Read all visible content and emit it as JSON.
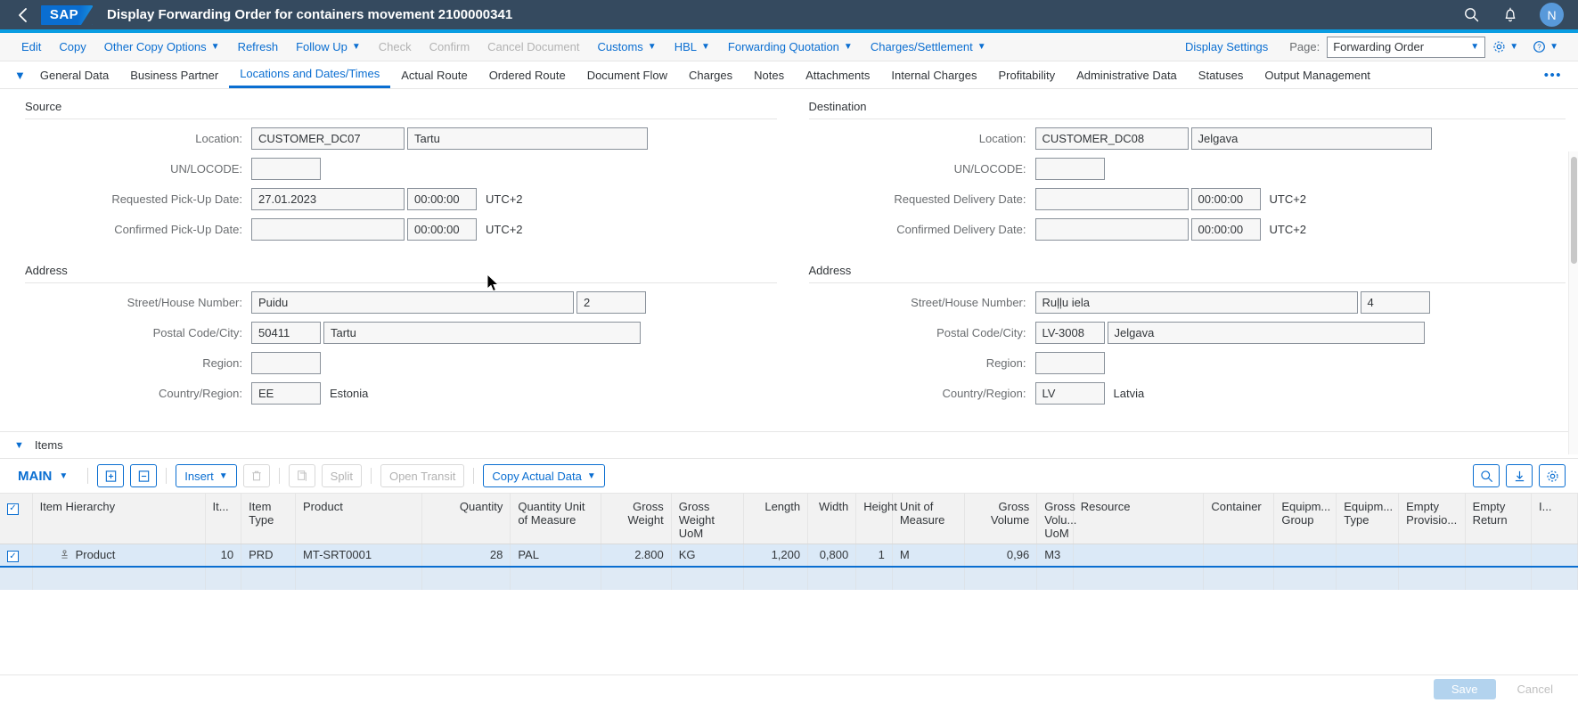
{
  "shell": {
    "back_icon": "chevron-left-icon",
    "logo_text": "SAP",
    "title": "Display Forwarding Order for containers movement 2100000341",
    "search_icon": "search-icon",
    "bell_icon": "notification-bell-icon",
    "avatar_initial": "N"
  },
  "toolbar": {
    "items": [
      {
        "label": "Edit",
        "disabled": false,
        "menu": false
      },
      {
        "label": "Copy",
        "disabled": false,
        "menu": false
      },
      {
        "label": "Other Copy Options",
        "disabled": false,
        "menu": true
      },
      {
        "label": "Refresh",
        "disabled": false,
        "menu": false
      },
      {
        "label": "Follow Up",
        "disabled": false,
        "menu": true
      },
      {
        "label": "Check",
        "disabled": true,
        "menu": false
      },
      {
        "label": "Confirm",
        "disabled": true,
        "menu": false
      },
      {
        "label": "Cancel Document",
        "disabled": true,
        "menu": false
      },
      {
        "label": "Customs",
        "disabled": false,
        "menu": true
      },
      {
        "label": "HBL",
        "disabled": false,
        "menu": true
      },
      {
        "label": "Forwarding Quotation",
        "disabled": false,
        "menu": true
      },
      {
        "label": "Charges/Settlement",
        "disabled": false,
        "menu": true
      }
    ],
    "display_settings": "Display Settings",
    "page_label": "Page:",
    "page_value": "Forwarding Order",
    "settings_icon": "gear-icon",
    "help_icon": "help-question-icon"
  },
  "tabs": {
    "expand_icon": "chevron-down-icon",
    "items": [
      "General Data",
      "Business Partner",
      "Locations and Dates/Times",
      "Actual Route",
      "Ordered Route",
      "Document Flow",
      "Charges",
      "Notes",
      "Attachments",
      "Internal Charges",
      "Profitability",
      "Administrative Data",
      "Statuses",
      "Output Management"
    ],
    "active": "Locations and Dates/Times",
    "overflow": "•••"
  },
  "source": {
    "section_title": "Source",
    "address_title": "Address",
    "fields": {
      "location_label": "Location:",
      "location_code": "CUSTOMER_DC07",
      "location_name": "Tartu",
      "unlocode_label": "UN/LOCODE:",
      "unlocode_value": "",
      "requested_label": "Requested Pick-Up Date:",
      "requested_date": "27.01.2023",
      "requested_time": "00:00:00",
      "requested_tz": "UTC+2",
      "confirmed_label": "Confirmed Pick-Up Date:",
      "confirmed_date": "",
      "confirmed_time": "00:00:00",
      "confirmed_tz": "UTC+2",
      "street_label": "Street/House Number:",
      "street": "Puidu",
      "house": "2",
      "postal_label": "Postal Code/City:",
      "postal": "50411",
      "city": "Tartu",
      "region_label": "Region:",
      "region": "",
      "country_label": "Country/Region:",
      "country_code": "EE",
      "country_name": "Estonia"
    }
  },
  "destination": {
    "section_title": "Destination",
    "address_title": "Address",
    "fields": {
      "location_label": "Location:",
      "location_code": "CUSTOMER_DC08",
      "location_name": "Jelgava",
      "unlocode_label": "UN/LOCODE:",
      "unlocode_value": "",
      "requested_label": "Requested Delivery Date:",
      "requested_date": "",
      "requested_time": "00:00:00",
      "requested_tz": "UTC+2",
      "confirmed_label": "Confirmed Delivery Date:",
      "confirmed_date": "",
      "confirmed_time": "00:00:00",
      "confirmed_tz": "UTC+2",
      "street_label": "Street/House Number:",
      "street": "Ruļļu iela",
      "house": "4",
      "postal_label": "Postal Code/City:",
      "postal": "LV-3008",
      "city": "Jelgava",
      "region_label": "Region:",
      "region": "",
      "country_label": "Country/Region:",
      "country_code": "LV",
      "country_name": "Latvia"
    }
  },
  "items": {
    "section_label": "Items",
    "variant": "MAIN",
    "buttons": {
      "insert_row_icon": "insert-row-icon",
      "delete_row_icon": "remove-row-icon",
      "insert": "Insert",
      "trash_icon": "trash-icon",
      "duplicate_icon": "duplicate-icon",
      "split": "Split",
      "open_transit": "Open Transit",
      "copy_actual_data": "Copy Actual Data",
      "search_icon": "search-icon",
      "download_icon": "download-icon",
      "settings_icon": "gear-icon"
    },
    "columns": [
      "Item Hierarchy",
      "It...",
      "Item Type",
      "Product",
      "Quantity",
      "Quantity Unit of Measure",
      "Gross Weight",
      "Gross Weight UoM",
      "Length",
      "Width",
      "Height",
      "Unit of Measure",
      "Gross Volume",
      "Gross Volu... UoM",
      "Resource",
      "Container",
      "Equipm... Group",
      "Equipm... Type",
      "Empty Provisio...",
      "Empty Return",
      "I..."
    ],
    "rows": [
      {
        "selected": true,
        "hierarchy": "Product",
        "item_no": "10",
        "item_type": "PRD",
        "product": "MT-SRT0001",
        "quantity": "28",
        "quantity_uom": "PAL",
        "gross_weight": "2.800",
        "gross_weight_uom": "KG",
        "length": "1,200",
        "width": "0,800",
        "height": "1",
        "unit_of_measure": "M",
        "gross_volume": "0,96",
        "gross_volume_uom": "M3",
        "resource": "",
        "container": "",
        "equipment_group": "",
        "equipment_type": "",
        "empty_provision": "",
        "empty_return": "",
        "extra": ""
      }
    ]
  },
  "footer": {
    "save": "Save",
    "cancel": "Cancel"
  },
  "colors": {
    "shell_bg": "#354a5f",
    "accent": "#0a9de2",
    "link": "#0a6ed1",
    "row_selected": "#dbe9f7"
  }
}
